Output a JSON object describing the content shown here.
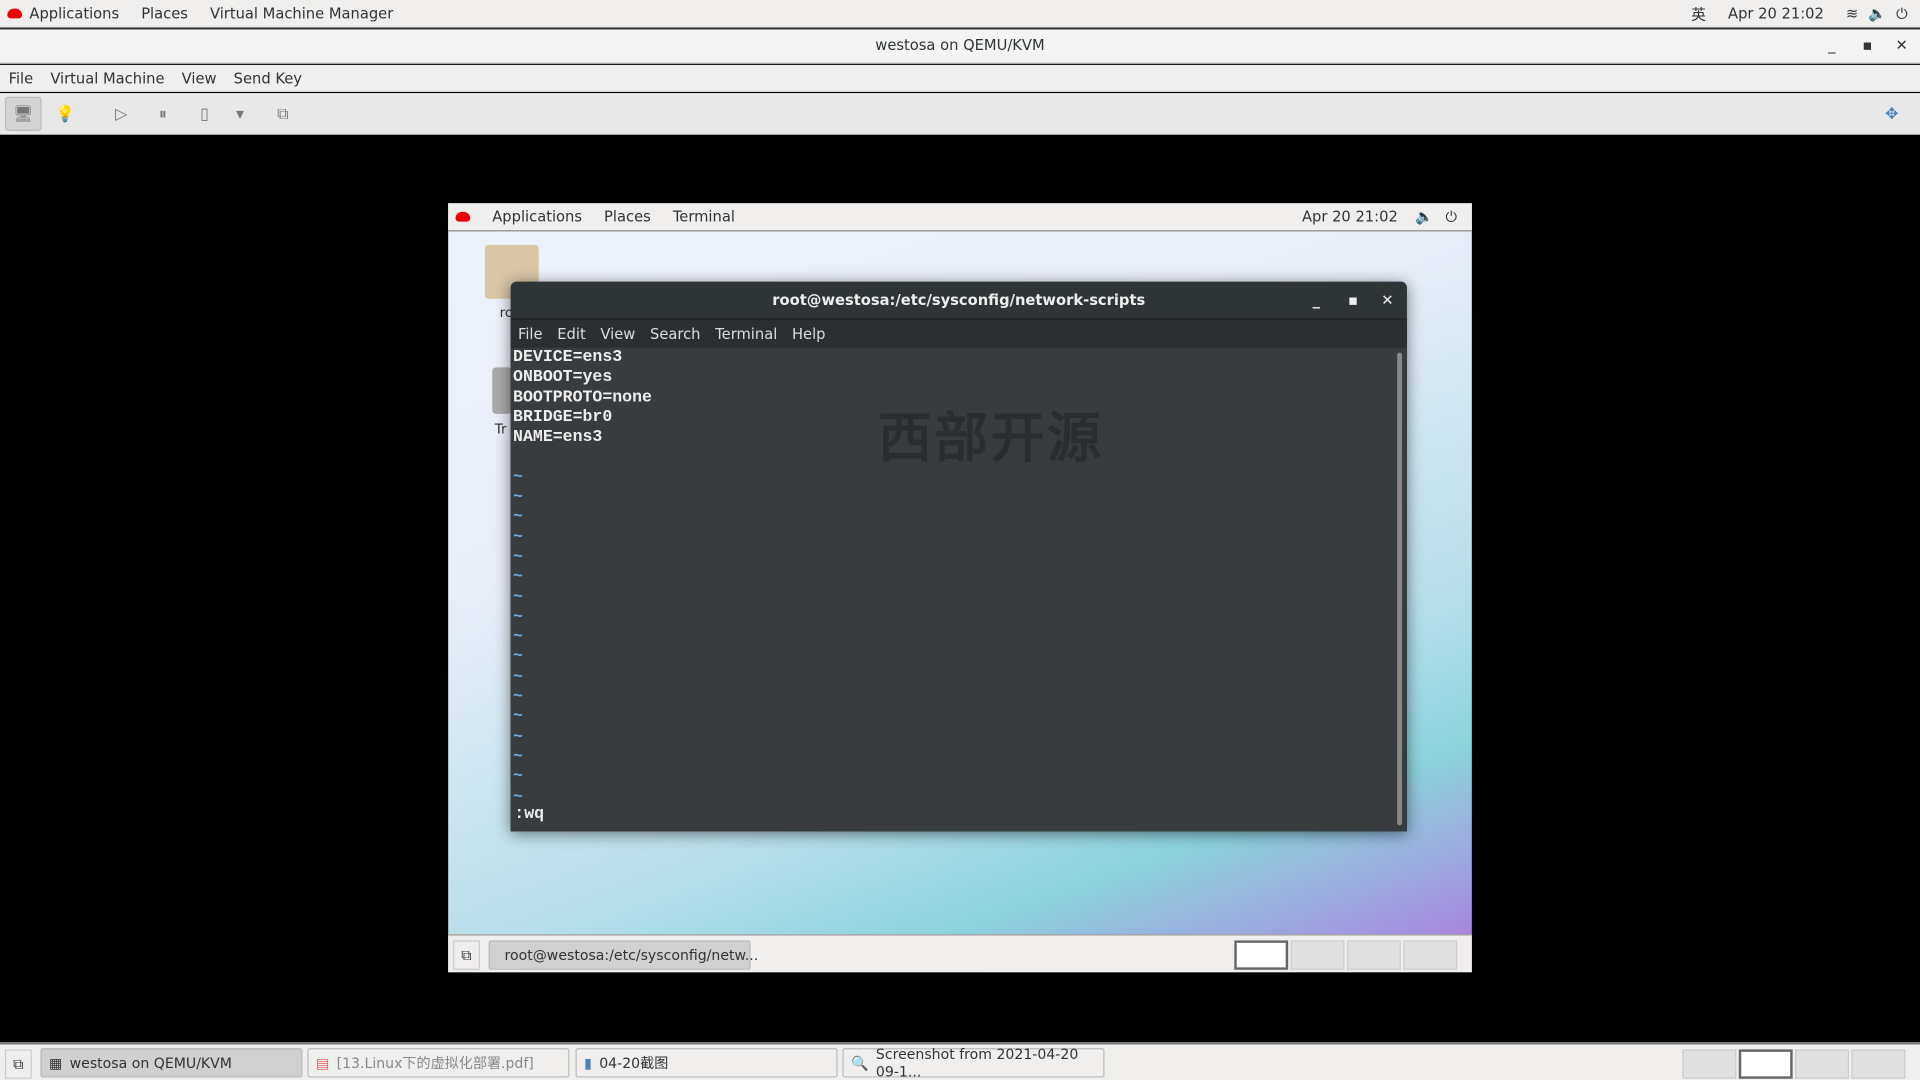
{
  "host_topbar": {
    "items": [
      "Applications",
      "Places",
      "Virtual Machine Manager"
    ],
    "input_method": "英",
    "clock": "Apr 20 21:02"
  },
  "window": {
    "title": "westosa on QEMU/KVM",
    "menu": [
      "File",
      "Virtual Machine",
      "View",
      "Send Key"
    ]
  },
  "guest": {
    "topbar": {
      "items": [
        "Applications",
        "Places",
        "Terminal"
      ],
      "clock": "Apr 20 21:02"
    },
    "desktop_icons": [
      "ro",
      "Tr"
    ],
    "terminal": {
      "title": "root@westosa:/etc/sysconfig/network-scripts",
      "menu": [
        "File",
        "Edit",
        "View",
        "Search",
        "Terminal",
        "Help"
      ],
      "lines": [
        "DEVICE=ens3",
        "ONBOOT=yes",
        "BOOTPROTO=none",
        "BRIDGE=br0",
        "NAME=ens3",
        ""
      ],
      "tilde_count": 17,
      "command": ":wq",
      "watermark": "西部开源"
    },
    "taskbar": {
      "task": "root@westosa:/etc/sysconfig/netw..."
    }
  },
  "host_taskbar": {
    "tasks": [
      "westosa on QEMU/KVM",
      "[13.Linux下的虚拟化部署.pdf]",
      "04-20截图",
      "Screenshot from 2021-04-20 09-1..."
    ]
  }
}
